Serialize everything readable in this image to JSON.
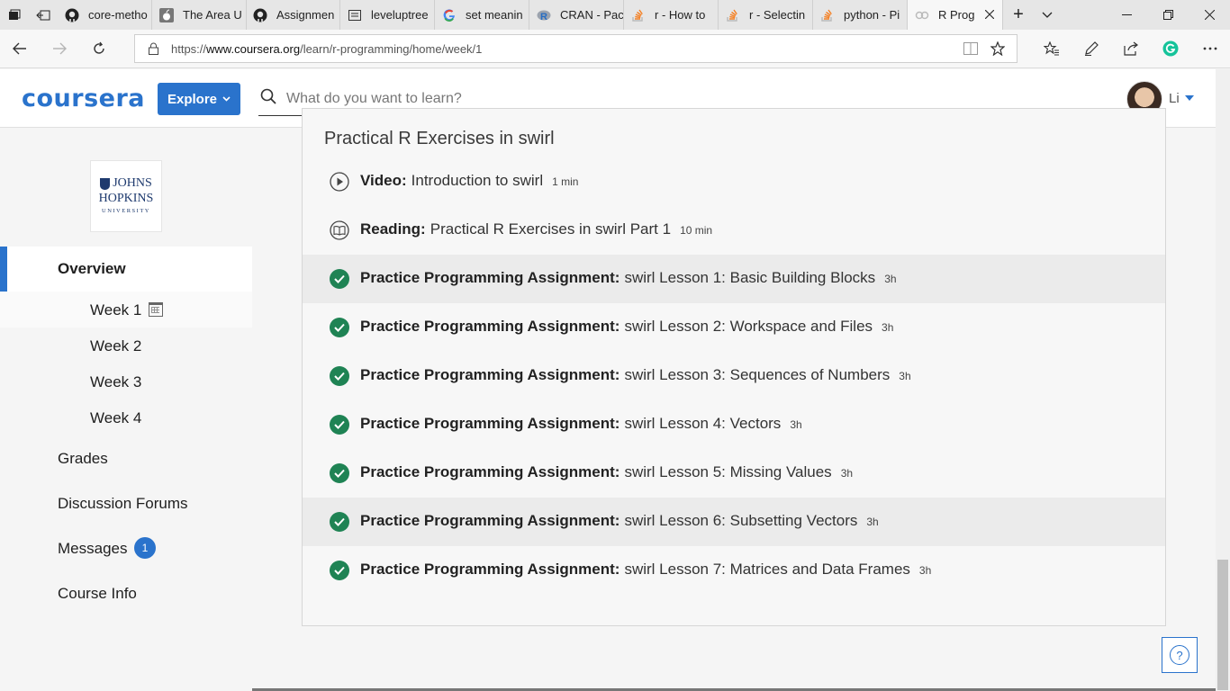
{
  "browser": {
    "tabs": [
      {
        "title": "core-metho",
        "favicon": "github-icon"
      },
      {
        "title": "The Area U",
        "favicon": "apple-icon"
      },
      {
        "title": "Assignmen",
        "favicon": "github-icon"
      },
      {
        "title": "leveluptree",
        "favicon": "page-icon"
      },
      {
        "title": "set meanin",
        "favicon": "google-icon"
      },
      {
        "title": "CRAN - Pac",
        "favicon": "r-icon"
      },
      {
        "title": "r - How to",
        "favicon": "stackoverflow-icon"
      },
      {
        "title": "r - Selectin",
        "favicon": "stackoverflow-icon"
      },
      {
        "title": "python - Pi",
        "favicon": "stackoverflow-icon"
      },
      {
        "title": "R Prog",
        "favicon": "coursera-icon",
        "active": true
      }
    ],
    "url_prefix": "https://",
    "url_domain": "www.coursera.org",
    "url_path": "/learn/r-programming/home/week/1"
  },
  "header": {
    "logo": "coursera",
    "explore_label": "Explore",
    "search_placeholder": "What do you want to learn?",
    "user_name": "Li"
  },
  "sidebar": {
    "university_logo": {
      "line1": "JOHNS",
      "line2": "HOPKINS",
      "line3": "UNIVERSITY"
    },
    "overview_label": "Overview",
    "weeks": [
      "Week 1",
      "Week 2",
      "Week 3",
      "Week 4"
    ],
    "grades_label": "Grades",
    "forums_label": "Discussion Forums",
    "messages_label": "Messages",
    "messages_count": "1",
    "course_info_label": "Course Info"
  },
  "main": {
    "section_title": "Practical R Exercises in swirl",
    "items": [
      {
        "kind": "Video:",
        "title": "Introduction to swirl",
        "duration": "1 min",
        "icon": "play-icon",
        "completed": false
      },
      {
        "kind": "Reading:",
        "title": "Practical R Exercises in swirl Part 1",
        "duration": "10 min",
        "icon": "book-icon",
        "completed": false
      },
      {
        "kind": "Practice Programming Assignment:",
        "title": "swirl Lesson 1: Basic Building Blocks",
        "duration": "3h",
        "icon": "check-circle-icon",
        "completed": true
      },
      {
        "kind": "Practice Programming Assignment:",
        "title": "swirl Lesson 2: Workspace and Files",
        "duration": "3h",
        "icon": "check-circle-icon",
        "completed": true
      },
      {
        "kind": "Practice Programming Assignment:",
        "title": "swirl Lesson 3: Sequences of Numbers",
        "duration": "3h",
        "icon": "check-circle-icon",
        "completed": true
      },
      {
        "kind": "Practice Programming Assignment:",
        "title": "swirl Lesson 4: Vectors",
        "duration": "3h",
        "icon": "check-circle-icon",
        "completed": true
      },
      {
        "kind": "Practice Programming Assignment:",
        "title": "swirl Lesson 5: Missing Values",
        "duration": "3h",
        "icon": "check-circle-icon",
        "completed": true
      },
      {
        "kind": "Practice Programming Assignment:",
        "title": "swirl Lesson 6: Subsetting Vectors",
        "duration": "3h",
        "icon": "check-circle-icon",
        "completed": true
      },
      {
        "kind": "Practice Programming Assignment:",
        "title": "swirl Lesson 7: Matrices and Data Frames",
        "duration": "3h",
        "icon": "check-circle-icon",
        "completed": true
      }
    ]
  },
  "colors": {
    "brand": "#2a73cc",
    "complete": "#1f8354",
    "badge": "#2a73cc"
  }
}
